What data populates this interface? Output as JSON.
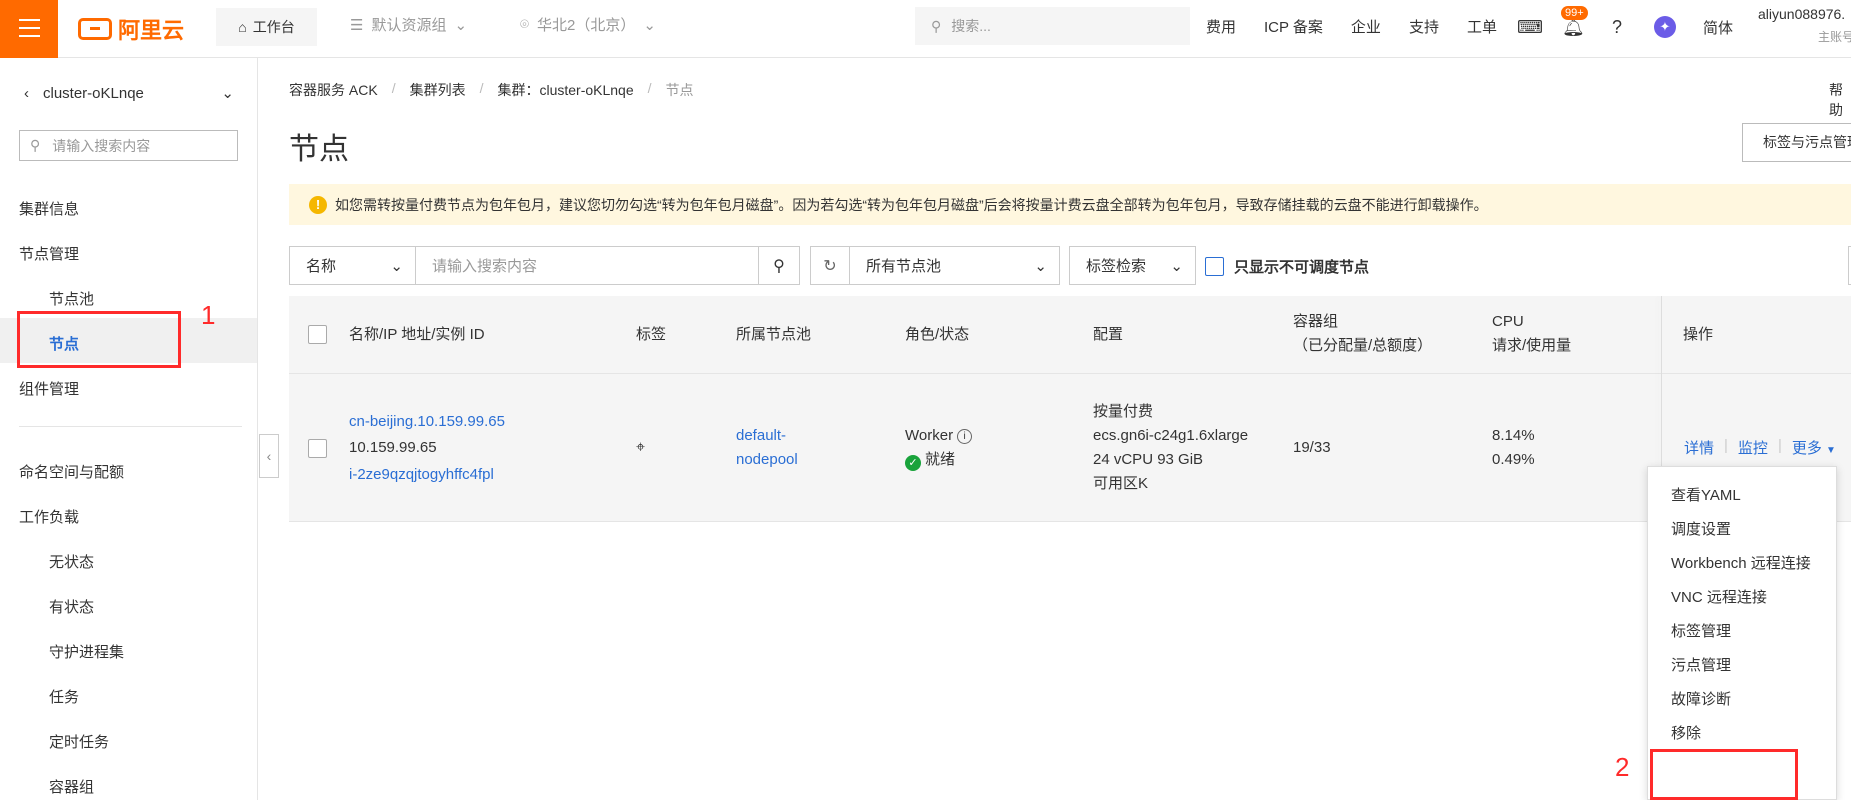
{
  "topbar": {
    "logo_text": "阿里云",
    "workbench": "工作台",
    "resource_group": "默认资源组",
    "region": "华北2（北京）",
    "search_placeholder": "搜索...",
    "links": [
      "费用",
      "ICP 备案",
      "企业",
      "支持",
      "工单"
    ],
    "notification_badge": "99+",
    "language": "简体",
    "user_name": "aliyun088976.",
    "user_sub": "主账号"
  },
  "sidebar": {
    "cluster_name": "cluster-oKLnqe",
    "search_placeholder": "请输入搜索内容",
    "items": {
      "cluster_info": "集群信息",
      "node_mgmt": "节点管理",
      "node_pool": "节点池",
      "nodes": "节点",
      "component_mgmt": "组件管理",
      "namespace_quota": "命名空间与配额",
      "workloads": "工作负载",
      "stateless": "无状态",
      "stateful": "有状态",
      "daemonset": "守护进程集",
      "jobs": "任务",
      "cronjobs": "定时任务",
      "pods": "容器组"
    }
  },
  "breadcrumb": {
    "items": [
      "容器服务 ACK",
      "集群列表",
      "集群：cluster-oKLnqe",
      "节点"
    ],
    "separator": "/"
  },
  "help": "帮助",
  "page_title": "节点",
  "taint_button": "标签与污点管理",
  "alert_text": "如您需转按量付费节点为包年包月，建议您切勿勾选“转为包年包月磁盘”。因为若勾选“转为包年包月磁盘”后会将按量计费云盘全部转为包年包月，导致存储挂载的云盘不能进行卸载操作。",
  "filter": {
    "field_select": "名称",
    "search_placeholder": "请输入搜索内容",
    "nodepool_select": "所有节点池",
    "label_search": "标签检索",
    "unschedulable_only": "只显示不可调度节点"
  },
  "table": {
    "headers": {
      "name": "名称/IP 地址/实例 ID",
      "labels": "标签",
      "nodepool": "所属节点池",
      "role_status": "角色/状态",
      "config": "配置",
      "pods_line1": "容器组",
      "pods_line2": "（已分配量/总额度）",
      "cpu_line1": "CPU",
      "cpu_line2": "请求/使用量",
      "ops": "操作"
    },
    "rows": [
      {
        "name": "cn-beijing.10.159.99.65",
        "ip": "10.159.99.65",
        "instance_id": "i-2ze9qzqjtogyhffc4fpl",
        "nodepool_line1": "default-",
        "nodepool_line2": "nodepool",
        "role": "Worker",
        "status": "就绪",
        "billing": "按量付费",
        "instance_type": "ecs.gn6i-c24g1.6xlarge",
        "spec": "24 vCPU 93 GiB",
        "zone": "可用区K",
        "pods": "19/33",
        "cpu_request": "8.14%",
        "cpu_usage": "0.49%",
        "op_detail": "详情",
        "op_monitor": "监控",
        "op_more": "更多"
      }
    ]
  },
  "more_menu": [
    "查看YAML",
    "调度设置",
    "Workbench 远程连接",
    "VNC 远程连接",
    "标签管理",
    "污点管理",
    "故障诊断",
    "移除"
  ],
  "annotations": {
    "step1": "1",
    "step2": "2"
  },
  "colors": {
    "brand": "#ff6a00",
    "link": "#2a6ed4",
    "annotation": "#ff2a2a",
    "alert_bg": "#fff7df",
    "success": "#19a33b"
  }
}
